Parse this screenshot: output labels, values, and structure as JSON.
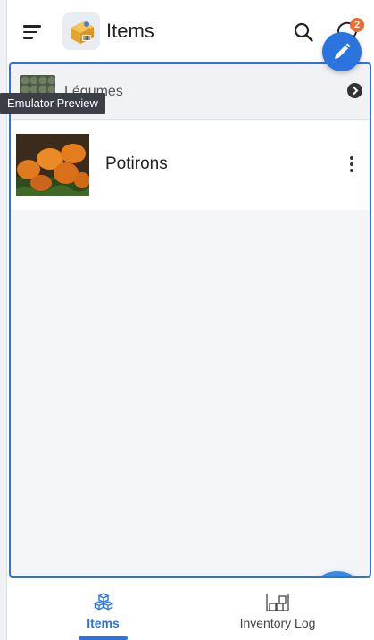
{
  "header": {
    "title": "Items",
    "notification_count": "2",
    "menu_icon": "hamburger-menu-icon",
    "logo_icon": "package-box-icon",
    "search_icon": "search-icon",
    "notification_icon": "chat-bubble-icon",
    "edit_icon": "pencil-icon"
  },
  "category": {
    "label": "Légumes",
    "arrow_icon": "chevron-right-circle-icon"
  },
  "items": [
    {
      "name": "Potirons",
      "more_icon": "more-vertical-icon"
    }
  ],
  "tooltip": {
    "text": "Emulator Preview"
  },
  "fab": {
    "icon": "plus-icon"
  },
  "bottom_nav": {
    "tabs": [
      {
        "label": "Items",
        "icon": "cubes-icon",
        "active": true
      },
      {
        "label": "Inventory Log",
        "icon": "warehouse-shelves-icon",
        "active": false
      }
    ]
  },
  "colors": {
    "accent": "#2b74dd",
    "fab": "#3c8ae3",
    "badge": "#f26a2b"
  }
}
